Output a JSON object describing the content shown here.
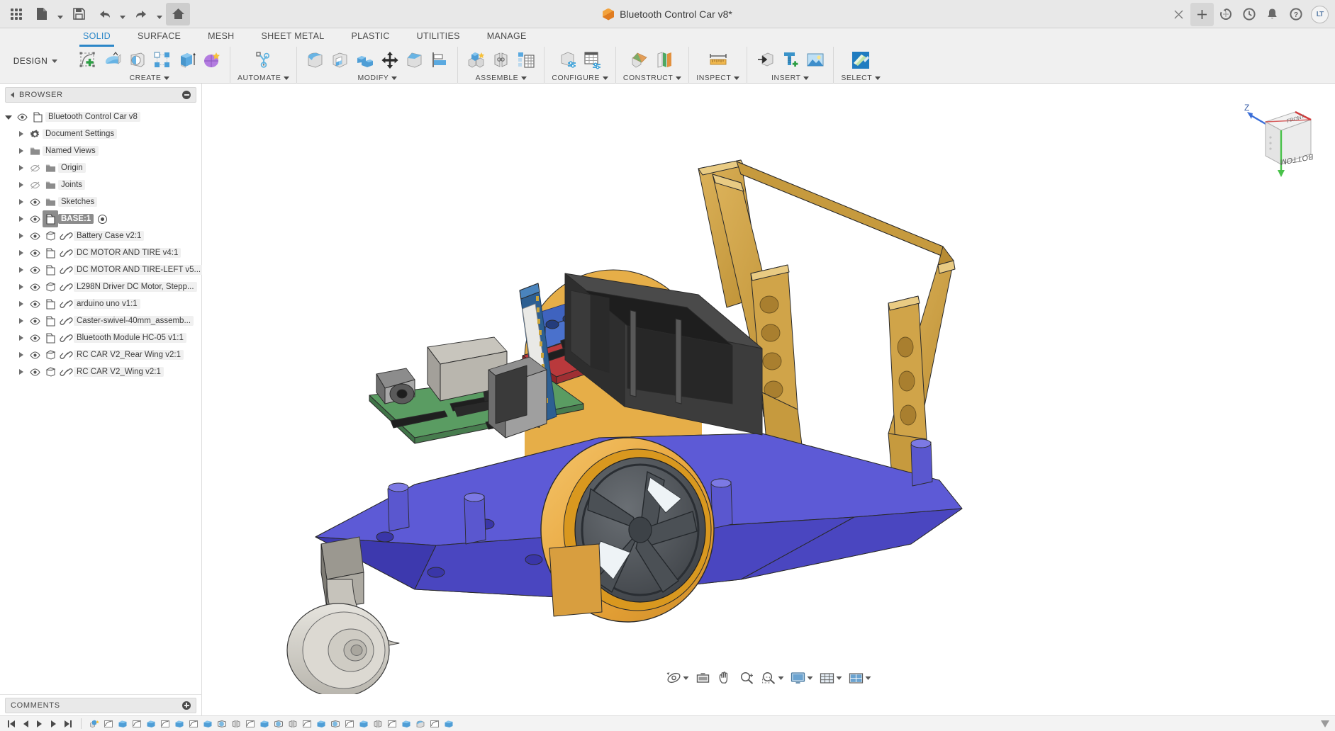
{
  "app": {
    "document_title": "Bluetooth Control Car v8*",
    "workspace": "DESIGN"
  },
  "titlebar": {
    "left_icons": [
      {
        "name": "app-grid-icon",
        "label": "Show Data Panel"
      },
      {
        "name": "new-file-icon",
        "label": "File"
      },
      {
        "name": "save-icon",
        "label": "Save"
      },
      {
        "name": "undo-icon",
        "label": "Undo"
      },
      {
        "name": "redo-icon",
        "label": "Redo"
      },
      {
        "name": "home-icon",
        "label": "Home"
      }
    ],
    "right_icons": [
      {
        "name": "close-tab-icon",
        "label": "Close"
      },
      {
        "name": "new-tab-icon",
        "label": "New Tab"
      },
      {
        "name": "sync-icon",
        "label": "Refresh"
      },
      {
        "name": "recent-icon",
        "label": "Recent"
      },
      {
        "name": "notifications-icon",
        "label": "Notifications"
      },
      {
        "name": "help-icon",
        "label": "Help"
      }
    ],
    "avatar_initials": "LT"
  },
  "ribbon": {
    "tabs": [
      {
        "label": "SOLID",
        "selected": true
      },
      {
        "label": "SURFACE",
        "selected": false
      },
      {
        "label": "MESH",
        "selected": false
      },
      {
        "label": "SHEET METAL",
        "selected": false
      },
      {
        "label": "PLASTIC",
        "selected": false
      },
      {
        "label": "UTILITIES",
        "selected": false
      },
      {
        "label": "MANAGE",
        "selected": false
      }
    ],
    "panels": [
      {
        "label": "CREATE",
        "has_dropdown": true,
        "buttons": [
          {
            "name": "create-sketch-button",
            "label": "Create Sketch"
          },
          {
            "name": "extrude-button",
            "label": "Extrude"
          },
          {
            "name": "revolve-button",
            "label": "Revolve"
          },
          {
            "name": "pattern-button",
            "label": "Rectangular Pattern"
          },
          {
            "name": "box-button",
            "label": "Box"
          },
          {
            "name": "form-button",
            "label": "Create Form"
          }
        ]
      },
      {
        "label": "AUTOMATE",
        "has_dropdown": true,
        "buttons": [
          {
            "name": "automated-modeling-button",
            "label": "Automated Modeling"
          }
        ]
      },
      {
        "label": "MODIFY",
        "has_dropdown": true,
        "buttons": [
          {
            "name": "fillet-button",
            "label": "Fillet"
          },
          {
            "name": "shell-button",
            "label": "Shell"
          },
          {
            "name": "combine-button",
            "label": "Combine"
          },
          {
            "name": "move-copy-button",
            "label": "Move/Copy"
          },
          {
            "name": "chamfer-button",
            "label": "Chamfer"
          },
          {
            "name": "align-button",
            "label": "Align"
          }
        ]
      },
      {
        "label": "ASSEMBLE",
        "has_dropdown": true,
        "buttons": [
          {
            "name": "new-component-button",
            "label": "New Component"
          },
          {
            "name": "joint-button",
            "label": "Joint"
          },
          {
            "name": "bom-button",
            "label": "Bill of Materials"
          }
        ]
      },
      {
        "label": "CONFIGURE",
        "has_dropdown": true,
        "buttons": [
          {
            "name": "configure-design-button",
            "label": "Configure Design"
          },
          {
            "name": "configuration-table-button",
            "label": "Configuration Table"
          }
        ]
      },
      {
        "label": "CONSTRUCT",
        "has_dropdown": true,
        "buttons": [
          {
            "name": "offset-plane-button",
            "label": "Offset Plane"
          },
          {
            "name": "plane-through-button",
            "label": "Plane Through Two Edges"
          }
        ]
      },
      {
        "label": "INSPECT",
        "has_dropdown": true,
        "buttons": [
          {
            "name": "measure-button",
            "label": "Measure"
          }
        ]
      },
      {
        "label": "INSERT",
        "has_dropdown": true,
        "buttons": [
          {
            "name": "insert-derive-button",
            "label": "Derive"
          },
          {
            "name": "insert-mcmaster-button",
            "label": "Insert McMaster-Carr Component"
          },
          {
            "name": "canvas-button",
            "label": "Canvas"
          }
        ]
      },
      {
        "label": "SELECT",
        "has_dropdown": true,
        "buttons": [
          {
            "name": "select-button",
            "label": "Select"
          }
        ]
      }
    ]
  },
  "browser": {
    "title": "BROWSER",
    "collapse_icon": "minus-circle-icon",
    "root": {
      "label": "Bluetooth Control Car v8",
      "icon": "component-icon",
      "expanded": true,
      "visible": true
    },
    "items": [
      {
        "label": "Document Settings",
        "icon": "gear-icon",
        "indent": 1,
        "eye": false,
        "link": false,
        "selected": false
      },
      {
        "label": "Named Views",
        "icon": "folder-icon",
        "indent": 1,
        "eye": false,
        "link": false,
        "selected": false
      },
      {
        "label": "Origin",
        "icon": "folder-icon",
        "indent": 1,
        "eye": true,
        "eye_off": true,
        "link": false,
        "selected": false
      },
      {
        "label": "Joints",
        "icon": "folder-icon",
        "indent": 1,
        "eye": true,
        "eye_off": true,
        "link": false,
        "selected": false
      },
      {
        "label": "Sketches",
        "icon": "folder-icon",
        "indent": 1,
        "eye": true,
        "eye_off": false,
        "link": false,
        "selected": false
      },
      {
        "label": "BASE:1",
        "icon": "component-icon",
        "indent": 1,
        "eye": true,
        "eye_off": false,
        "link": false,
        "selected": true,
        "badge": "activated-dot-icon"
      },
      {
        "label": "Battery Case v2:1",
        "icon": "body-icon",
        "indent": 1,
        "eye": true,
        "eye_off": false,
        "link": true,
        "selected": false
      },
      {
        "label": "DC MOTOR AND TIRE v4:1",
        "icon": "component-icon",
        "indent": 1,
        "eye": true,
        "eye_off": false,
        "link": true,
        "selected": false
      },
      {
        "label": "DC MOTOR AND TIRE-LEFT v5...",
        "icon": "component-icon",
        "indent": 1,
        "eye": true,
        "eye_off": false,
        "link": true,
        "selected": false
      },
      {
        "label": "L298N Driver DC Motor, Stepp...",
        "icon": "body-icon",
        "indent": 1,
        "eye": true,
        "eye_off": false,
        "link": true,
        "selected": false
      },
      {
        "label": "arduino uno v1:1",
        "icon": "component-icon",
        "indent": 1,
        "eye": true,
        "eye_off": false,
        "link": true,
        "selected": false
      },
      {
        "label": "Caster-swivel-40mm_assemb...",
        "icon": "component-icon",
        "indent": 1,
        "eye": true,
        "eye_off": false,
        "link": true,
        "selected": false
      },
      {
        "label": "Bluetooth Module HC-05 v1:1",
        "icon": "component-icon",
        "indent": 1,
        "eye": true,
        "eye_off": false,
        "link": true,
        "selected": false
      },
      {
        "label": "RC CAR V2_Rear Wing v2:1",
        "icon": "body-icon",
        "indent": 1,
        "eye": true,
        "eye_off": false,
        "link": true,
        "selected": false
      },
      {
        "label": "RC CAR V2_Wing v2:1",
        "icon": "body-icon",
        "indent": 1,
        "eye": true,
        "eye_off": false,
        "link": true,
        "selected": false
      }
    ]
  },
  "comments": {
    "title": "COMMENTS",
    "add_icon": "plus-circle-icon"
  },
  "viewcube": {
    "top_face_label": "FRONT",
    "front_face_label": "BOTTOM",
    "axis_label": "Z"
  },
  "navbar": {
    "buttons": [
      {
        "name": "orbit-button",
        "label": "Orbit",
        "dropdown": true
      },
      {
        "name": "look-at-button",
        "label": "Look At",
        "dropdown": false
      },
      {
        "name": "pan-button",
        "label": "Pan",
        "dropdown": false
      },
      {
        "name": "zoom-button",
        "label": "Zoom",
        "dropdown": false
      },
      {
        "name": "zoom-window-button",
        "label": "Zoom Window",
        "dropdown": true
      },
      {
        "name": "display-settings-button",
        "label": "Display Settings",
        "dropdown": true
      },
      {
        "name": "grid-snaps-button",
        "label": "Grid and Snaps",
        "dropdown": true
      },
      {
        "name": "viewports-button",
        "label": "Viewports",
        "dropdown": true
      }
    ]
  },
  "timeline": {
    "controls": [
      {
        "name": "timeline-begin-button",
        "label": "Go to Beginning"
      },
      {
        "name": "timeline-step-back-button",
        "label": "Step Back"
      },
      {
        "name": "timeline-play-button",
        "label": "Play"
      },
      {
        "name": "timeline-step-forward-button",
        "label": "Step Forward"
      },
      {
        "name": "timeline-end-button",
        "label": "Go to End"
      }
    ],
    "feature_count": 26,
    "features": [
      "new-component",
      "sketch",
      "extrude",
      "sketch",
      "extrude",
      "sketch",
      "extrude",
      "sketch",
      "extrude",
      "revolve",
      "joint",
      "sketch",
      "extrude",
      "revolve",
      "joint",
      "sketch",
      "extrude",
      "revolve",
      "sketch",
      "extrude",
      "joint",
      "sketch",
      "extrude",
      "fillet",
      "sketch",
      "extrude"
    ],
    "end_marker": "timeline-end-marker"
  },
  "model": {
    "name": "Bluetooth Control Car",
    "colors": {
      "chassis": "#4b48c8",
      "chassis_light": "#6a67e0",
      "tire": "#e8a83c",
      "tire_light": "#f0bb5c",
      "rim": "#4e5257",
      "wing": "#c79a3e",
      "wing_light": "#d6ad52",
      "pcb_green": "#4f8f58",
      "pcb_red": "#b8373a",
      "battery_box": "#3b3b3b",
      "caster": "#c9c7c0",
      "bluetooth_board": "#2a5d8f"
    }
  }
}
